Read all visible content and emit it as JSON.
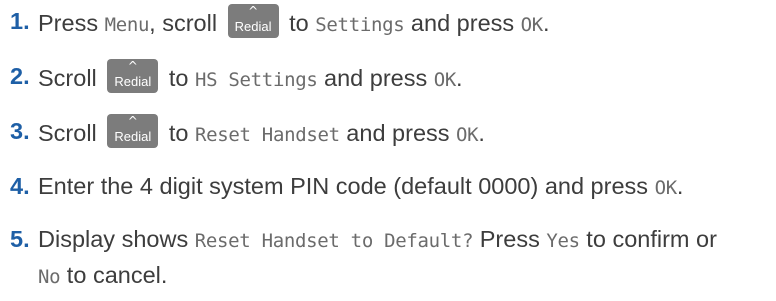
{
  "steps": [
    {
      "number": "1.",
      "t1": "Press ",
      "d1": "Menu",
      "t2": ", scroll ",
      "t3": " to ",
      "d2": "Settings",
      "t4": " and press ",
      "d3": "OK",
      "t5": "."
    },
    {
      "number": "2.",
      "t1": "Scroll ",
      "t2": " to ",
      "d1": "HS Settings",
      "t3": " and press ",
      "d2": "OK",
      "t4": "."
    },
    {
      "number": "3.",
      "t1": "Scroll ",
      "t2": " to ",
      "d1": "Reset Handset",
      "t3": " and press ",
      "d2": "OK",
      "t4": "."
    },
    {
      "number": "4.",
      "t1": "Enter the 4 digit system PIN code (default 0000) and press ",
      "d1": "OK",
      "t2": "."
    },
    {
      "number": "5.",
      "t1": "Display shows ",
      "d1": "Reset Handset to Default?",
      "t2": " Press ",
      "d2": "Yes",
      "t3": " to confirm or ",
      "d3": "No",
      "t4": " to cancel."
    }
  ],
  "redial_key": {
    "symbol": "^",
    "label": "Redial"
  },
  "colors": {
    "number": "#1e5fa6",
    "text": "#3d3d3d",
    "display_text": "#6b6b6b",
    "key_background": "#7c7c7c"
  }
}
